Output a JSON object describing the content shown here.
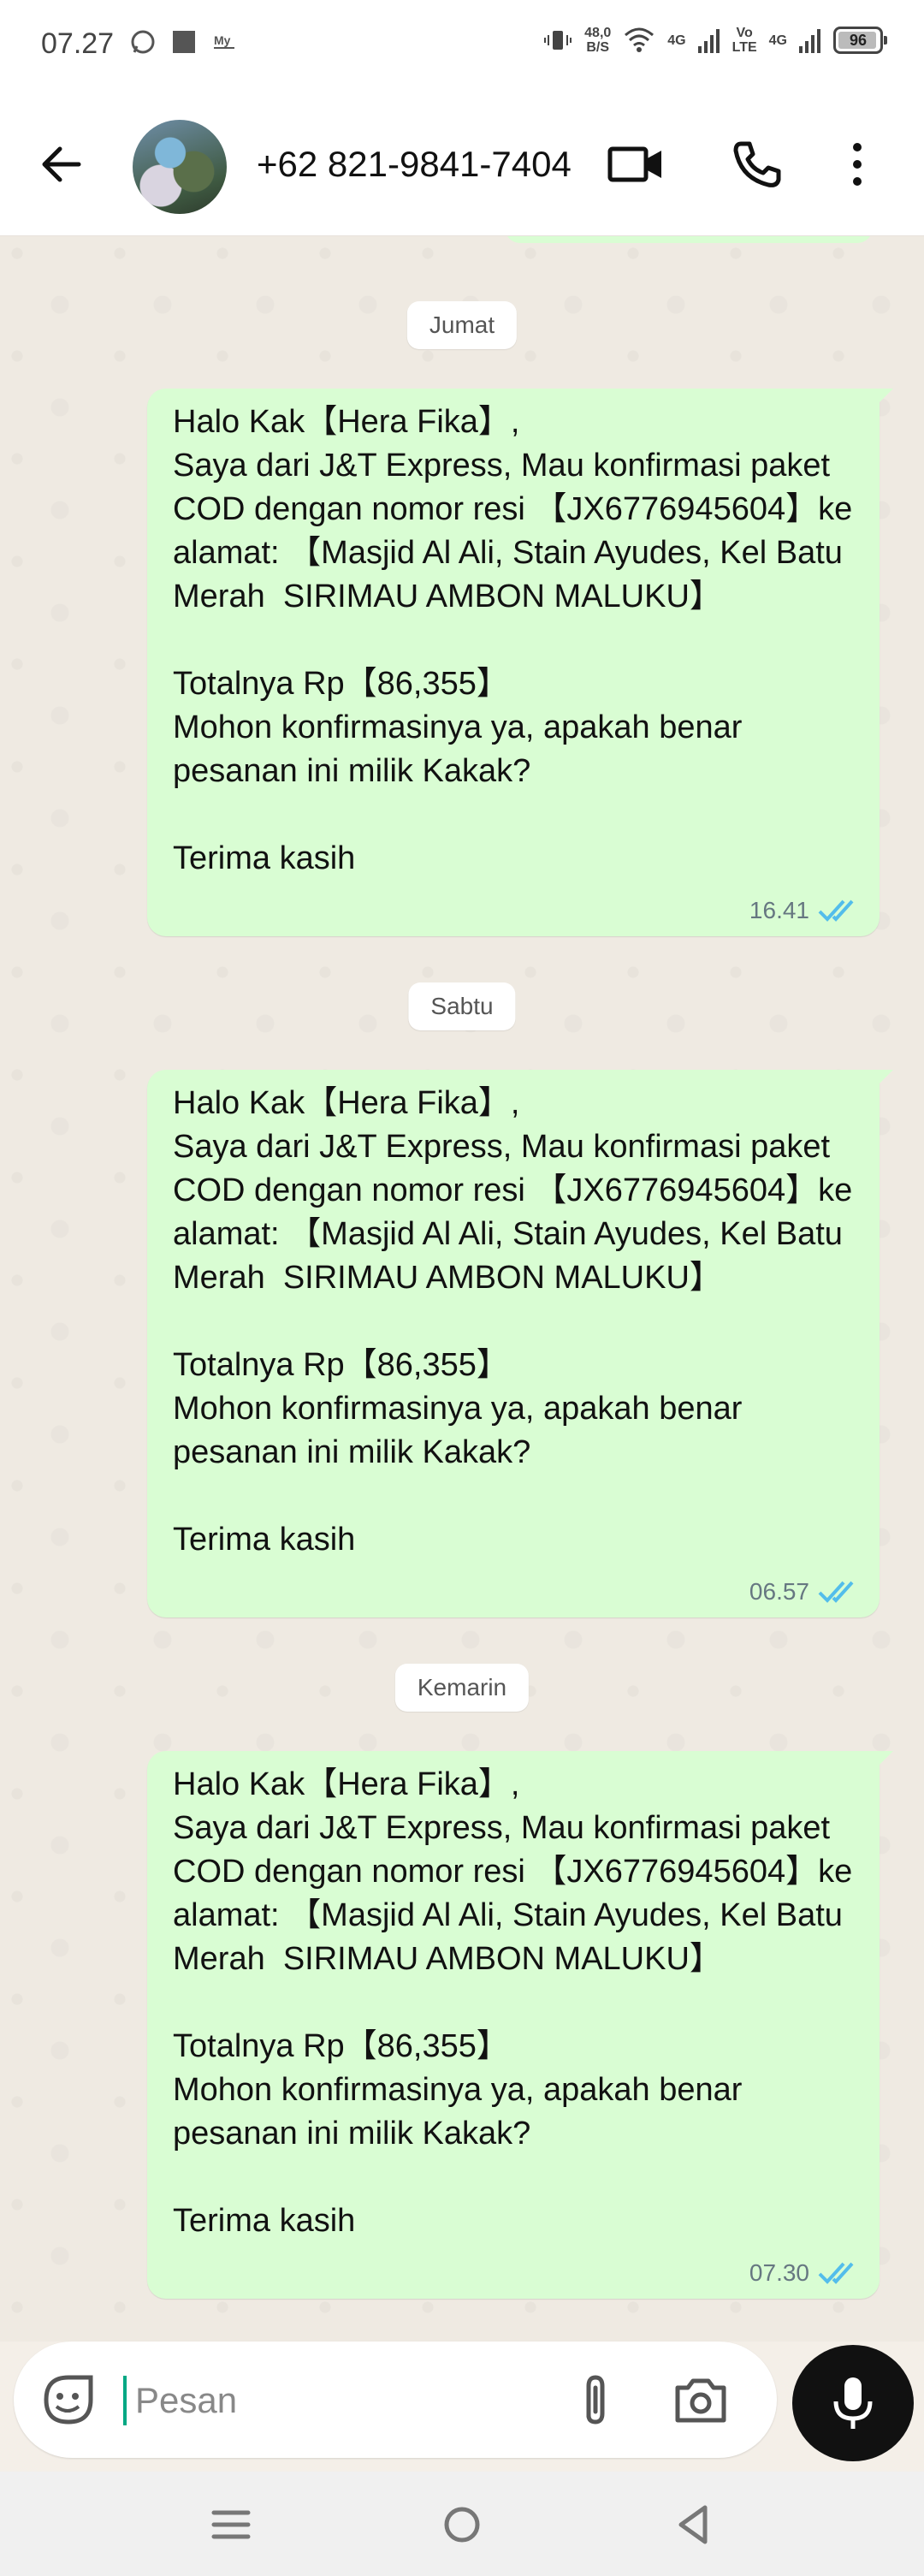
{
  "status_bar": {
    "time": "07.27",
    "net_speed_value": "48,0",
    "net_speed_unit": "B/S",
    "network_1": "4G",
    "volte_1": "Vo",
    "volte_2": "LTE",
    "network_2": "4G",
    "battery": "96",
    "battery_level": 0.96
  },
  "header": {
    "contact_name": "+62 821-9841-7404"
  },
  "messages": [
    {
      "date_chip": "Jumat",
      "text": "Halo Kak【Hera Fika】,\nSaya dari J&T Express, Mau konfirmasi paket COD dengan nomor resi 【JX6776945604】ke alamat: 【Masjid Al Ali, Stain Ayudes, Kel Batu Merah  SIRIMAU AMBON MALUKU】\n\nTotalnya Rp【86,355】\nMohon konfirmasinya ya, apakah benar pesanan ini milik Kakak?\n\nTerima kasih",
      "time": "16.41"
    },
    {
      "date_chip": "Sabtu",
      "text": "Halo Kak【Hera Fika】,\nSaya dari J&T Express, Mau konfirmasi paket COD dengan nomor resi 【JX6776945604】ke alamat: 【Masjid Al Ali, Stain Ayudes, Kel Batu Merah  SIRIMAU AMBON MALUKU】\n\nTotalnya Rp【86,355】\nMohon konfirmasinya ya, apakah benar pesanan ini milik Kakak?\n\nTerima kasih",
      "time": "06.57"
    },
    {
      "date_chip": "Kemarin",
      "text": "Halo Kak【Hera Fika】,\nSaya dari J&T Express, Mau konfirmasi paket COD dengan nomor resi 【JX6776945604】ke alamat: 【Masjid Al Ali, Stain Ayudes, Kel Batu Merah  SIRIMAU AMBON MALUKU】\n\nTotalnya Rp【86,355】\nMohon konfirmasinya ya, apakah benar pesanan ini milik Kakak?\n\nTerima kasih",
      "time": "07.30"
    }
  ],
  "composer": {
    "placeholder": "Pesan"
  },
  "colors": {
    "bubble": "#d9fdd3",
    "read_ticks": "#53bdeb",
    "chat_bg": "#efeae2"
  },
  "icons": [
    "back-arrow-icon",
    "video-call-icon",
    "phone-call-icon",
    "more-options-icon",
    "sticker-icon",
    "attach-icon",
    "camera-icon",
    "mic-icon",
    "double-check-icon"
  ]
}
